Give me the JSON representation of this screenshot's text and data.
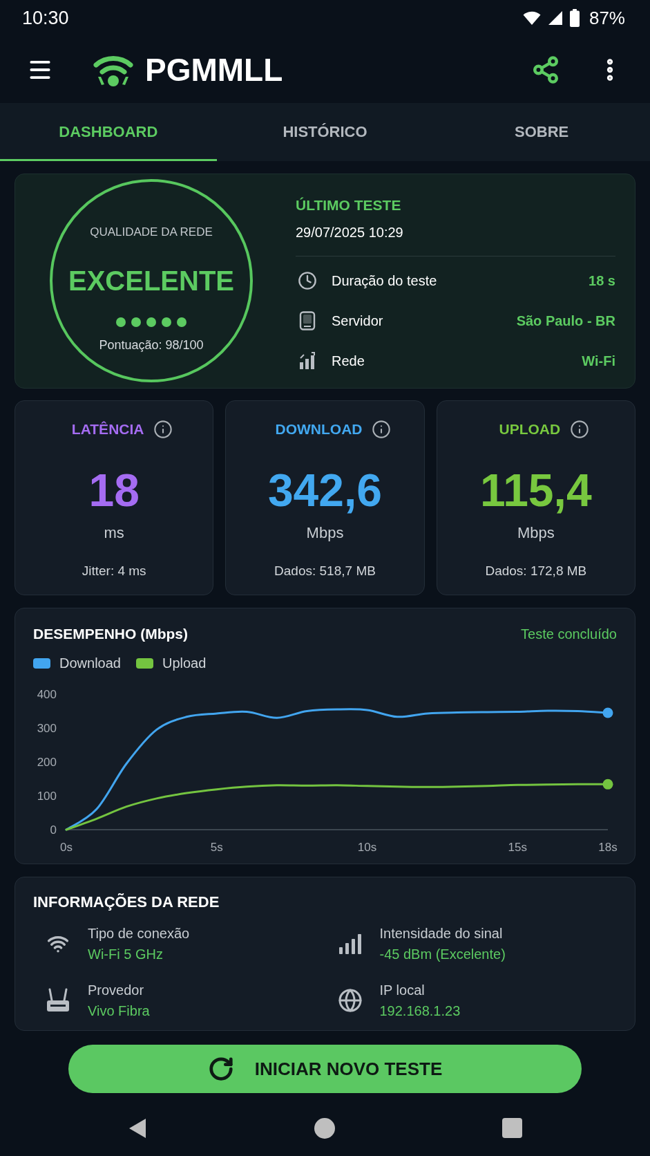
{
  "status_bar": {
    "time": "10:30",
    "battery": "87%"
  },
  "app_bar": {
    "title": "PGMMLL"
  },
  "tabs": [
    {
      "label": "DASHBOARD",
      "selected": true
    },
    {
      "label": "HISTÓRICO",
      "selected": false
    },
    {
      "label": "SOBRE",
      "selected": false
    }
  ],
  "quality": {
    "caption": "QUALIDADE DA REDE",
    "rating": "EXCELENTE",
    "stars": 5,
    "score": "Pontuação: 98/100"
  },
  "last_test": {
    "title": "ÚLTIMO TESTE",
    "datetime": "29/07/2025 10:29",
    "rows": [
      {
        "label": "Duração do teste",
        "value": "18 s"
      },
      {
        "label": "Servidor",
        "value": "São Paulo - BR"
      },
      {
        "label": "Rede",
        "value": "Wi-Fi"
      }
    ]
  },
  "metrics": [
    {
      "title": "LATÊNCIA",
      "color": "#a56cf2",
      "value": "18",
      "unit": "ms",
      "detail": "Jitter: 4 ms"
    },
    {
      "title": "DOWNLOAD",
      "color": "#42a8f0",
      "value": "342,6",
      "unit": "Mbps",
      "detail": "Dados: 518,7 MB"
    },
    {
      "title": "UPLOAD",
      "color": "#78c83f",
      "value": "115,4",
      "unit": "Mbps",
      "detail": "Dados: 172,8 MB"
    }
  ],
  "performance": {
    "status": "Teste concluído",
    "chart_data": {
      "type": "line",
      "title": "DESEMPENHO (Mbps)",
      "x": [
        0,
        1,
        2,
        3,
        4,
        5,
        6,
        7,
        8,
        9,
        10,
        11,
        12,
        13,
        14,
        15,
        16,
        17,
        18
      ],
      "series": [
        {
          "name": "Download",
          "color": "#42a5ef",
          "values": [
            0,
            60,
            195,
            295,
            333,
            343,
            348,
            330,
            350,
            355,
            353,
            333,
            343,
            346,
            347,
            348,
            351,
            350,
            345
          ]
        },
        {
          "name": "Upload",
          "color": "#74c440",
          "values": [
            0,
            32,
            68,
            92,
            108,
            119,
            127,
            131,
            130,
            131,
            129,
            127,
            126,
            127,
            129,
            132,
            133,
            134,
            134
          ]
        }
      ],
      "xlim": [
        0,
        18
      ],
      "ylim": [
        0,
        400
      ],
      "xticks": [
        {
          "value": 0,
          "label": "0s"
        },
        {
          "value": 5,
          "label": "5s"
        },
        {
          "value": 10,
          "label": "10s"
        },
        {
          "value": 15,
          "label": "15s"
        },
        {
          "value": 18,
          "label": "18s"
        }
      ],
      "yticks": [
        0,
        100,
        200,
        300,
        400
      ]
    }
  },
  "network_info": {
    "title": "INFORMAÇÕES DA REDE",
    "items": [
      {
        "label": "Tipo de conexão",
        "value": "Wi-Fi 5 GHz"
      },
      {
        "label": "Intensidade do sinal",
        "value": "-45 dBm (Excelente)"
      },
      {
        "label": "Provedor",
        "value": "Vivo Fibra"
      },
      {
        "label": "IP local",
        "value": "192.168.1.23"
      }
    ]
  },
  "action_button": {
    "label": "INICIAR NOVO TESTE"
  }
}
